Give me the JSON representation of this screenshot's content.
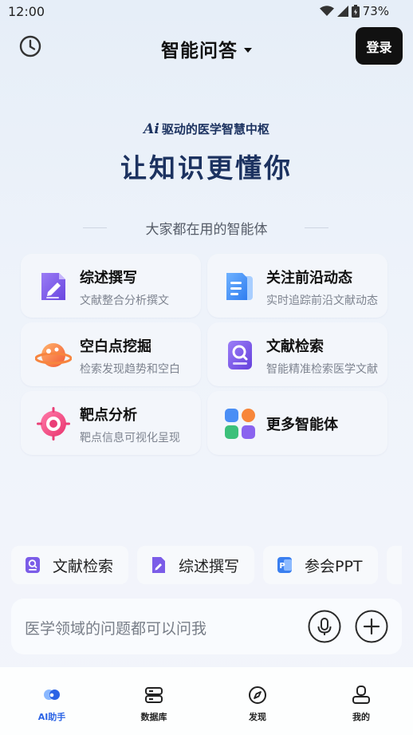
{
  "status_bar": {
    "time": "12:00",
    "battery": "73%"
  },
  "header": {
    "title": "智能问答",
    "login_label": "登录"
  },
  "slogan": {
    "logo": "Ai",
    "text": "驱动的医学智慧中枢"
  },
  "hero": {
    "title": "让知识更懂你"
  },
  "agents_section": {
    "title": "大家都在用的智能体",
    "cards": [
      {
        "title": "综述撰写",
        "desc": "文献整合分析撰文",
        "icon": "document-pen-icon"
      },
      {
        "title": "关注前沿动态",
        "desc": "实时追踪前沿文献动态",
        "icon": "document-stack-icon"
      },
      {
        "title": "空白点挖掘",
        "desc": "检索发现趋势和空白",
        "icon": "planet-icon"
      },
      {
        "title": "文献检索",
        "desc": "智能精准检索医学文献",
        "icon": "document-search-icon"
      },
      {
        "title": "靶点分析",
        "desc": "靶点信息可视化呈现",
        "icon": "target-icon"
      },
      {
        "title": "更多智能体",
        "desc": "",
        "icon": "grid-apps-icon"
      }
    ]
  },
  "quick_actions": [
    {
      "label": "文献检索",
      "icon": "document-search-icon"
    },
    {
      "label": "综述撰写",
      "icon": "document-pen-icon"
    },
    {
      "label": "参会PPT",
      "icon": "ppt-icon"
    }
  ],
  "input": {
    "placeholder": "医学领域的问题都可以问我"
  },
  "tabbar": [
    {
      "label": "AI助手",
      "active": true
    },
    {
      "label": "数据库",
      "active": false
    },
    {
      "label": "发现",
      "active": false
    },
    {
      "label": "我的",
      "active": false
    }
  ],
  "colors": {
    "accent": "#2b63e5",
    "brand_navy": "#1c3260",
    "purple": "#7b5ce8"
  }
}
